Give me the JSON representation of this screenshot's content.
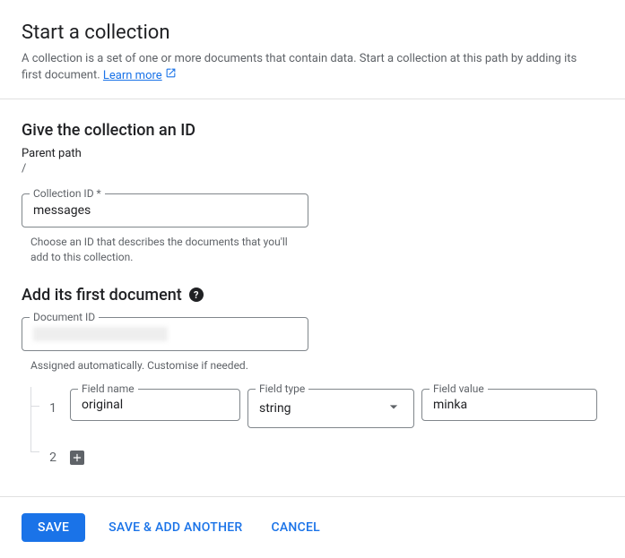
{
  "header": {
    "title": "Start a collection",
    "description": "A collection is a set of one or more documents that contain data. Start a collection at this path by adding its first document.",
    "learn_more": "Learn more"
  },
  "collection": {
    "subtitle": "Give the collection an ID",
    "parent_path_label": "Parent path",
    "parent_path_value": "/",
    "collection_id_label": "Collection ID *",
    "collection_id_value": "messages",
    "collection_id_helper": "Choose an ID that describes the documents that you'll add to this collection."
  },
  "document": {
    "subtitle": "Add its first document",
    "document_id_label": "Document ID",
    "document_id_value": "",
    "document_id_helper": "Assigned automatically. Customise if needed.",
    "rows": [
      {
        "num": "1",
        "field_name_label": "Field name",
        "field_name_value": "original",
        "field_type_label": "Field type",
        "field_type_value": "string",
        "field_value_label": "Field value",
        "field_value_value": "minka"
      }
    ],
    "row2_num": "2"
  },
  "footer": {
    "save": "SAVE",
    "save_add_another": "SAVE & ADD ANOTHER",
    "cancel": "CANCEL"
  }
}
